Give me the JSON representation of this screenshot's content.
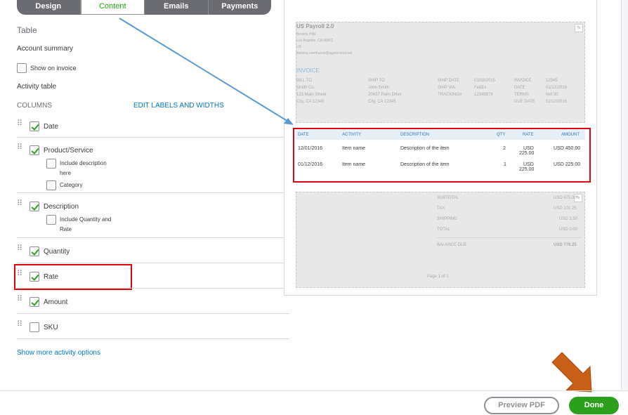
{
  "tabs": [
    {
      "label": "Design"
    },
    {
      "label": "Content"
    },
    {
      "label": "Emails"
    },
    {
      "label": "Payments"
    }
  ],
  "content": {
    "table_heading": "Table",
    "account_summary": "Account summary",
    "show_on_invoice": "Show on invoice",
    "activity_table": "Activity table",
    "columns_label": "COLUMNS",
    "edit_labels": "EDIT LABELS AND WIDTHS",
    "columns": [
      {
        "label": "Date",
        "checked": true
      },
      {
        "label": "Product/Service",
        "checked": true
      },
      {
        "label": "Description",
        "checked": true
      },
      {
        "label": "Quantity",
        "checked": true
      },
      {
        "label": "Rate",
        "checked": true
      },
      {
        "label": "Amount",
        "checked": true
      },
      {
        "label": "SKU",
        "checked": false
      }
    ],
    "include_description": "Include description",
    "include_description_2": "here",
    "category": "Category",
    "include_qty": "Include Quantity and",
    "include_qty_2": "Rate",
    "show_more": "Show more activity options"
  },
  "preview": {
    "company": "US Payroll 2.0",
    "addr": [
      "Beverly Hills",
      "Los Angeles, CA 90001",
      "US",
      "theresa.cornhuson@agent.intuit.net"
    ],
    "invoice_title": "INVOICE",
    "bill_to_label": "BILL TO",
    "bill_to": [
      "Smith Co.",
      "123 Main Street",
      "City, CA 12345"
    ],
    "ship_to_label": "SHIP TO",
    "ship_to": [
      "John Smith",
      "20637 Palm Drive",
      "City, CA 12345"
    ],
    "ship_date_label": "SHIP DATE",
    "ship_date": "01/03/2015",
    "ship_via_label": "SHIP VIA",
    "ship_via": "FedEx",
    "tracking_label": "TRACKING#",
    "tracking": "12345678",
    "invoice_label": "INVOICE",
    "invoice_no": "12345",
    "date_label": "DATE",
    "date": "01/12/2016",
    "terms_label": "TERMS",
    "terms": "Net 30",
    "due_label": "DUE DATE",
    "due": "02/12/2016",
    "table_headers": [
      "DATE",
      "ACTIVITY",
      "DESCRIPTION",
      "QTY",
      "RATE",
      "AMOUNT"
    ],
    "rows": [
      {
        "date": "12/01/2016",
        "activity": "Item name",
        "desc": "Description of the item",
        "qty": "2",
        "rate1": "USD",
        "rate2": "225.00",
        "amount": "USD 450.00"
      },
      {
        "date": "01/12/2016",
        "activity": "Item name",
        "desc": "Description of the item",
        "qty": "1",
        "rate1": "USD",
        "rate2": "225.00",
        "amount": "USD 225.00"
      }
    ],
    "subtotal_label": "SUBTOTAL",
    "subtotal": "USD 675.00",
    "tax_label": "TAX",
    "tax": "USD 101.25",
    "shipping_label": "SHIPPING",
    "shipping": "USD 3.50",
    "total_label": "TOTAL",
    "total": "USD 0.00",
    "balance_label": "BALANCE DUE",
    "balance": "USD 776.25",
    "page": "Page 1 of 1"
  },
  "footer": {
    "preview_pdf": "Preview PDF",
    "done": "Done"
  },
  "colors": {
    "accent_green": "#2ca01c",
    "link_blue": "#0077c5",
    "highlight_red": "#e0000e",
    "arrow_orange": "#c8601a"
  }
}
